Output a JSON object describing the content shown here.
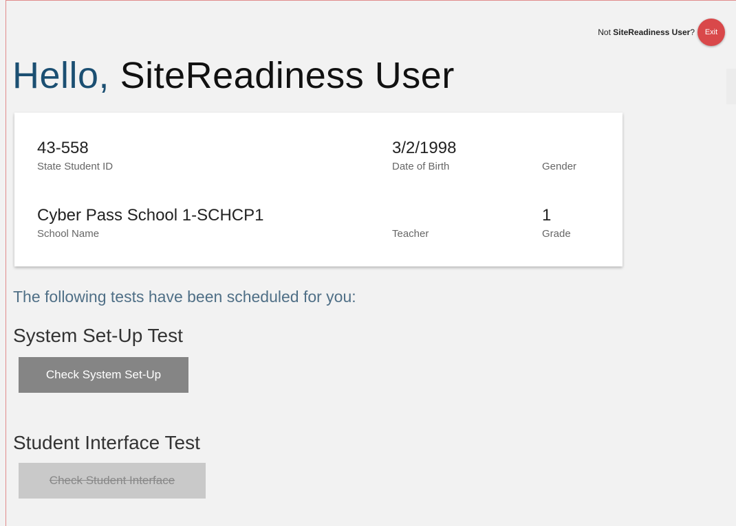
{
  "header": {
    "not_prefix": "Not ",
    "user_name": "SiteReadiness User",
    "not_suffix": "?",
    "exit_label": "Exit"
  },
  "greeting": {
    "hello": "Hello,",
    "name": "SiteReadiness User"
  },
  "student": {
    "student_id": "43-558",
    "student_id_label": "State Student ID",
    "dob": "3/2/1998",
    "dob_label": "Date of Birth",
    "gender": "",
    "gender_label": "Gender",
    "school": "Cyber Pass School 1-SCHCP1",
    "school_label": "School Name",
    "teacher": "",
    "teacher_label": "Teacher",
    "grade": "1",
    "grade_label": "Grade"
  },
  "tests": {
    "intro": "The following tests have been scheduled for you:",
    "system": {
      "title": "System Set-Up Test",
      "button": "Check System Set-Up"
    },
    "interface": {
      "title": "Student Interface Test",
      "button": "Check Student Interface"
    }
  },
  "colors": {
    "accent_blue": "#1b4f72",
    "exit_red": "#d9484a",
    "primary_button": "#858585",
    "disabled_button": "#c9c9c9"
  }
}
